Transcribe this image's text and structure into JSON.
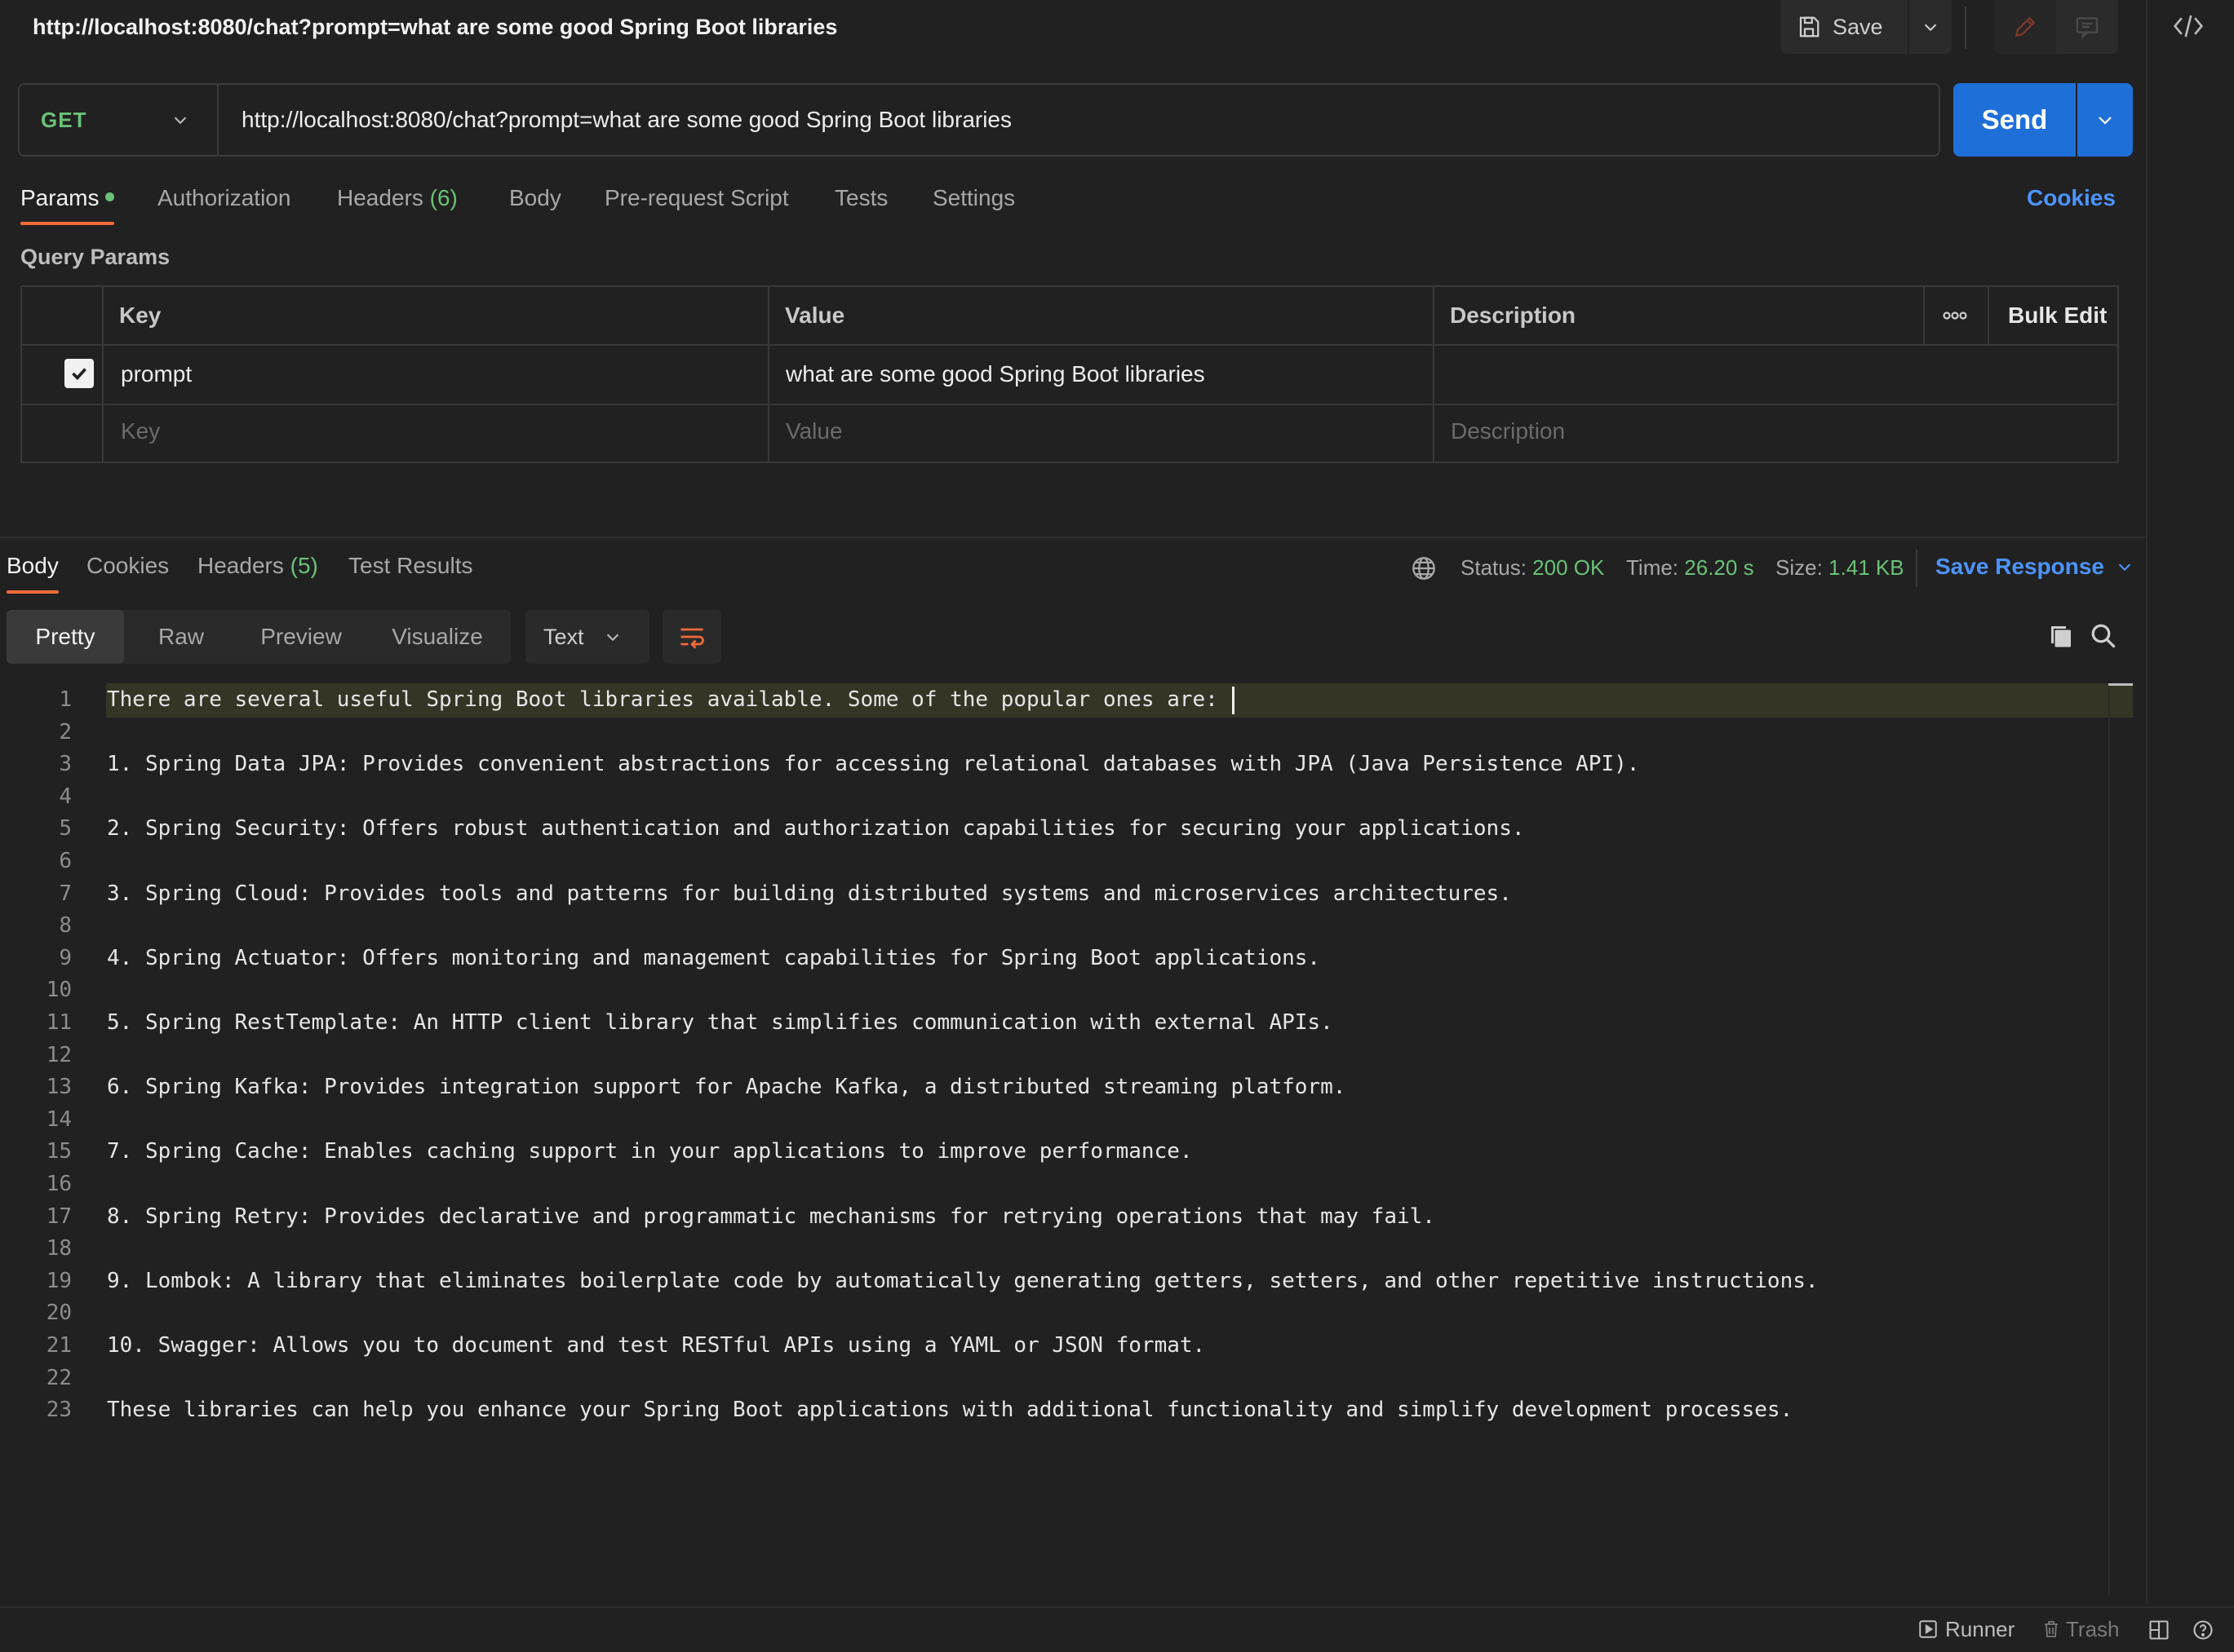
{
  "window": {
    "title": "http://localhost:8080/chat?prompt=what are some good Spring Boot libraries",
    "save_label": "Save"
  },
  "request": {
    "method": "GET",
    "url": "http://localhost:8080/chat?prompt=what are some good Spring Boot libraries",
    "send_label": "Send"
  },
  "request_tabs": {
    "params": "Params",
    "authorization": "Authorization",
    "headers": "Headers",
    "headers_count": "(6)",
    "body": "Body",
    "prerequest": "Pre-request Script",
    "tests": "Tests",
    "settings": "Settings",
    "cookies": "Cookies"
  },
  "query_params": {
    "section_label": "Query Params",
    "columns": {
      "key": "Key",
      "value": "Value",
      "description": "Description",
      "bulk_edit": "Bulk Edit"
    },
    "rows": [
      {
        "checked": true,
        "key": "prompt",
        "value": "what are some good Spring Boot libraries",
        "description": ""
      }
    ],
    "placeholders": {
      "key": "Key",
      "value": "Value",
      "description": "Description"
    }
  },
  "response_tabs": {
    "body": "Body",
    "cookies": "Cookies",
    "headers": "Headers",
    "headers_count": "(5)",
    "test_results": "Test Results"
  },
  "response_stats": {
    "status_label": "Status:",
    "status_value": "200 OK",
    "time_label": "Time:",
    "time_value": "26.20 s",
    "size_label": "Size:",
    "size_value": "1.41 KB",
    "save_response": "Save Response"
  },
  "view_modes": {
    "pretty": "Pretty",
    "raw": "Raw",
    "preview": "Preview",
    "visualize": "Visualize",
    "format": "Text"
  },
  "editor": {
    "line_numbers": [
      "1",
      "2",
      "3",
      "4",
      "5",
      "6",
      "7",
      "8",
      "9",
      "10",
      "11",
      "12",
      "13",
      "14",
      "15",
      "16",
      "17",
      "18",
      "19",
      "20",
      "21",
      "22",
      "23"
    ],
    "lines": [
      "There are several useful Spring Boot libraries available. Some of the popular ones are:",
      "",
      "1. Spring Data JPA: Provides convenient abstractions for accessing relational databases with JPA (Java Persistence API).",
      "",
      "2. Spring Security: Offers robust authentication and authorization capabilities for securing your applications.",
      "",
      "3. Spring Cloud: Provides tools and patterns for building distributed systems and microservices architectures.",
      "",
      "4. Spring Actuator: Offers monitoring and management capabilities for Spring Boot applications.",
      "",
      "5. Spring RestTemplate: An HTTP client library that simplifies communication with external APIs.",
      "",
      "6. Spring Kafka: Provides integration support for Apache Kafka, a distributed streaming platform.",
      "",
      "7. Spring Cache: Enables caching support in your applications to improve performance.",
      "",
      "8. Spring Retry: Provides declarative and programmatic mechanisms for retrying operations that may fail.",
      "",
      "9. Lombok: A library that eliminates boilerplate code by automatically generating getters, setters, and other repetitive instructions.",
      "",
      "10. Swagger: Allows you to document and test RESTful APIs using a YAML or JSON format.",
      "",
      "These libraries can help you enhance your Spring Boot applications with additional functionality and simplify development processes."
    ]
  },
  "status_bar": {
    "runner": "Runner",
    "trash": "Trash"
  },
  "colors": {
    "accent_orange": "#f26b3a",
    "send_blue": "#1f6fd8",
    "link_blue": "#4d94ff",
    "success_green": "#6bc178"
  },
  "icons": [
    "save-icon",
    "chevron-down-icon",
    "pencil-icon",
    "comment-icon",
    "code-icon",
    "globe-icon",
    "wrap-lines-icon",
    "copy-icon",
    "search-icon",
    "more-icon",
    "checkmark-icon",
    "runner-icon",
    "trash-icon",
    "layout-icon",
    "help-icon"
  ]
}
